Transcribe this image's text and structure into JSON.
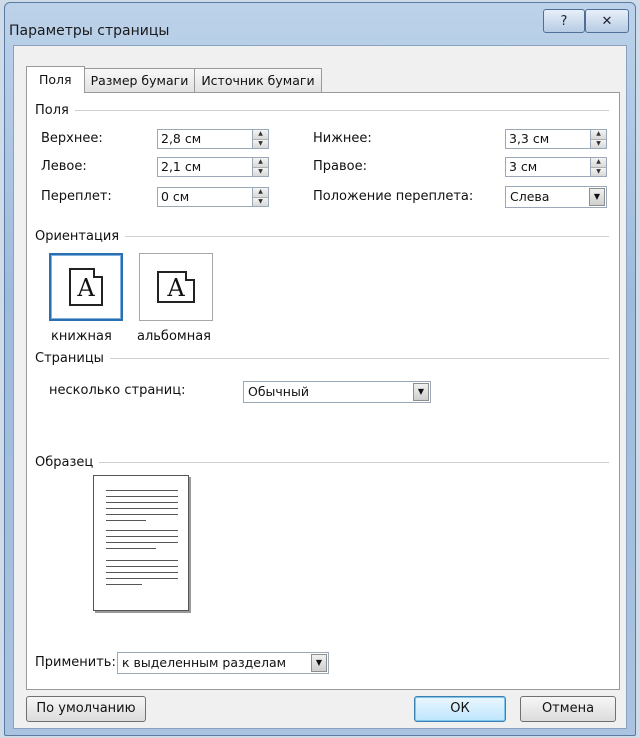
{
  "window": {
    "title": "Параметры страницы",
    "help_glyph": "?",
    "close_glyph": "✕"
  },
  "tabs": [
    {
      "label": "Поля",
      "active": true
    },
    {
      "label": "Размер бумаги",
      "active": false
    },
    {
      "label": "Источник бумаги",
      "active": false
    }
  ],
  "margins": {
    "group_title": "Поля",
    "top_label": "Верхнее:",
    "top_value": "2,8 см",
    "bottom_label": "Нижнее:",
    "bottom_value": "3,3 см",
    "left_label": "Левое:",
    "left_value": "2,1 см",
    "right_label": "Правое:",
    "right_value": "3 см",
    "gutter_label": "Переплет:",
    "gutter_value": "0 см",
    "gutter_pos_label": "Положение переплета:",
    "gutter_pos_value": "Слева"
  },
  "orientation": {
    "group_title": "Ориентация",
    "portrait_label": "книжная",
    "landscape_label": "альбомная",
    "icon_letter": "A",
    "selected": "portrait"
  },
  "pages": {
    "group_title": "Страницы",
    "multiple_label": "несколько страниц:",
    "multiple_value": "Обычный"
  },
  "preview": {
    "group_title": "Образец"
  },
  "apply": {
    "label": "Применить:",
    "value": "к выделенным разделам"
  },
  "buttons": {
    "default_label": "По умолчанию",
    "ok_label": "ОК",
    "cancel_label": "Отмена"
  }
}
